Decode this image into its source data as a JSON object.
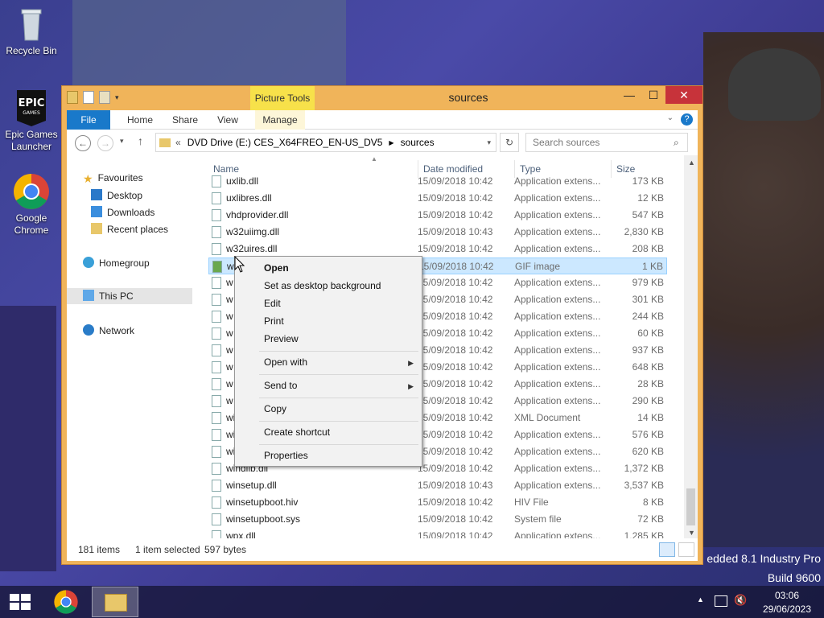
{
  "desktop": {
    "icons": [
      {
        "label": "Recycle Bin",
        "icon": "recycle-bin-icon"
      },
      {
        "label": "Epic Games Launcher",
        "icon": "epic-games-icon"
      },
      {
        "label": "Google Chrome",
        "icon": "chrome-icon"
      }
    ],
    "watermark_line1": "edded 8.1 Industry Pro",
    "watermark_line2": "Build 9600"
  },
  "window": {
    "title": "sources",
    "context_tab": "Picture Tools",
    "ribbon_tabs": [
      "File",
      "Home",
      "Share",
      "View",
      "Manage"
    ],
    "address": {
      "overflow": "«",
      "crumbs": [
        "DVD Drive (E:) CES_X64FREO_EN-US_DV5",
        "sources"
      ]
    },
    "search_placeholder": "Search sources",
    "nav": {
      "favourites": "Favourites",
      "desktop": "Desktop",
      "downloads": "Downloads",
      "recent": "Recent places",
      "homegroup": "Homegroup",
      "thispc": "This PC",
      "network": "Network"
    },
    "columns": {
      "name": "Name",
      "date": "Date modified",
      "type": "Type",
      "size": "Size"
    },
    "files": [
      {
        "name": "uxlib.dll",
        "date": "15/09/2018 10:42",
        "type": "Application extens...",
        "size": "173 KB"
      },
      {
        "name": "uxlibres.dll",
        "date": "15/09/2018 10:42",
        "type": "Application extens...",
        "size": "12 KB"
      },
      {
        "name": "vhdprovider.dll",
        "date": "15/09/2018 10:42",
        "type": "Application extens...",
        "size": "547 KB"
      },
      {
        "name": "w32uiimg.dll",
        "date": "15/09/2018 10:43",
        "type": "Application extens...",
        "size": "2,830 KB"
      },
      {
        "name": "w32uires.dll",
        "date": "15/09/2018 10:42",
        "type": "Application extens...",
        "size": "208 KB"
      },
      {
        "name": "w",
        "date": "15/09/2018 10:42",
        "type": "GIF image",
        "size": "1 KB"
      },
      {
        "name": "w",
        "date": "15/09/2018 10:42",
        "type": "Application extens...",
        "size": "979 KB"
      },
      {
        "name": "w",
        "date": "15/09/2018 10:42",
        "type": "Application extens...",
        "size": "301 KB"
      },
      {
        "name": "w",
        "date": "15/09/2018 10:42",
        "type": "Application extens...",
        "size": "244 KB"
      },
      {
        "name": "w",
        "date": "15/09/2018 10:42",
        "type": "Application extens...",
        "size": "60 KB"
      },
      {
        "name": "w",
        "date": "15/09/2018 10:42",
        "type": "Application extens...",
        "size": "937 KB"
      },
      {
        "name": "w",
        "date": "15/09/2018 10:42",
        "type": "Application extens...",
        "size": "648 KB"
      },
      {
        "name": "w",
        "date": "15/09/2018 10:42",
        "type": "Application extens...",
        "size": "28 KB"
      },
      {
        "name": "w",
        "date": "15/09/2018 10:42",
        "type": "Application extens...",
        "size": "290 KB"
      },
      {
        "name": "wi",
        "date": "15/09/2018 10:42",
        "type": "XML Document",
        "size": "14 KB"
      },
      {
        "name": "wi",
        "date": "15/09/2018 10:42",
        "type": "Application extens...",
        "size": "576 KB"
      },
      {
        "name": "wi",
        "date": "15/09/2018 10:42",
        "type": "Application extens...",
        "size": "620 KB"
      },
      {
        "name": "windlib.dll",
        "date": "15/09/2018 10:42",
        "type": "Application extens...",
        "size": "1,372 KB"
      },
      {
        "name": "winsetup.dll",
        "date": "15/09/2018 10:43",
        "type": "Application extens...",
        "size": "3,537 KB"
      },
      {
        "name": "winsetupboot.hiv",
        "date": "15/09/2018 10:42",
        "type": "HIV File",
        "size": "8 KB"
      },
      {
        "name": "winsetupboot.sys",
        "date": "15/09/2018 10:42",
        "type": "System file",
        "size": "72 KB"
      },
      {
        "name": "wpx.dll",
        "date": "15/09/2018 10:42",
        "type": "Application extens...",
        "size": "1,285 KB"
      }
    ],
    "status": {
      "items": "181 items",
      "selected": "1 item selected",
      "bytes": "597 bytes"
    }
  },
  "context_menu": {
    "open": "Open",
    "set_bg": "Set as desktop background",
    "edit": "Edit",
    "print": "Print",
    "preview": "Preview",
    "open_with": "Open with",
    "send_to": "Send to",
    "copy": "Copy",
    "create_shortcut": "Create shortcut",
    "properties": "Properties"
  },
  "taskbar": {
    "time": "03:06",
    "date": "29/06/2023"
  },
  "colors": {
    "accent": "#1979ca",
    "titlebar": "#f0b45a",
    "selection": "#cce8ff",
    "context_tab": "#f7e14a"
  }
}
